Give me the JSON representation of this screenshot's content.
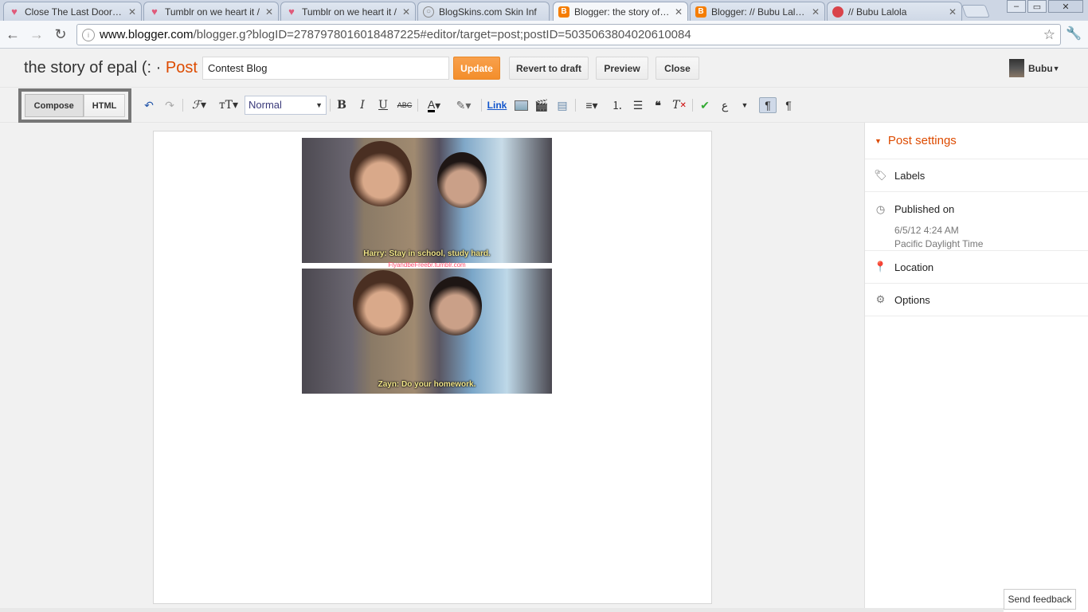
{
  "browser": {
    "tabs": [
      {
        "title": "Close The Last Door : 2",
        "favicon": "heart-icon"
      },
      {
        "title": "Tumblr on we heart it /",
        "favicon": "heart-icon"
      },
      {
        "title": "Tumblr on we heart it /",
        "favicon": "heart-icon"
      },
      {
        "title": "BlogSkins.com Skin Inf",
        "favicon": "globe-icon"
      },
      {
        "title": "Blogger: the story of ep",
        "favicon": "blogger-icon"
      },
      {
        "title": "Blogger: // Bubu Lalola",
        "favicon": "blogger-icon"
      },
      {
        "title": "// Bubu Lalola",
        "favicon": "strawberry-icon"
      }
    ],
    "url_host": "www.blogger.com",
    "url_path": "/blogger.g?blogID=2787978016018487225#editor/target=post;postID=5035063804020610084"
  },
  "header": {
    "blog_title": "the story of epal (: · ",
    "post_label": "Post",
    "post_title": "Contest Blog",
    "update": "Update",
    "revert": "Revert to draft",
    "preview": "Preview",
    "close": "Close",
    "user": "Bubu"
  },
  "toolbar": {
    "compose": "Compose",
    "html": "HTML",
    "format": "Normal",
    "link": "Link"
  },
  "editor": {
    "caption1": "Harry: Stay in school, study hard.",
    "watermark1": "FlyandbeFreebr.tumblr.com",
    "caption2": "Zayn: Do your homework."
  },
  "sidebar": {
    "heading": "Post settings",
    "labels": "Labels",
    "published": "Published on",
    "published_date": "6/5/12 4:24 AM",
    "published_tz": "Pacific Daylight Time",
    "location": "Location",
    "options": "Options"
  },
  "feedback": "Send feedback",
  "colors": {
    "accent": "#dd4b00",
    "update_button": "#f38e2b"
  }
}
